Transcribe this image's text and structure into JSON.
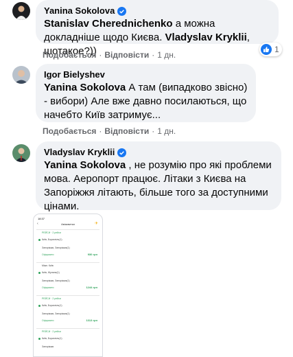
{
  "comments": [
    {
      "author": "Yanina Sokolova",
      "verified": true,
      "mention1": "Stanislav Cherednichenko",
      "text1": " а можна докладніше щодо Києва. ",
      "mention2": "Vladyslav Kryklii",
      "text2": ", шотакое?))",
      "like": "Подобається",
      "reply": "Відповісти",
      "time": "1 дн.",
      "reactions": "1"
    },
    {
      "author": "Igor Bielyshev",
      "verified": false,
      "mention1": "Yanina Sokolova",
      "text1": " А там (випадково звісно) - вибори) Але вже давно посилаються, що начебто Київ затримує...",
      "like": "Подобається",
      "reply": "Відповісти",
      "time": "1 дн."
    },
    {
      "author": "Vladyslav Kryklii",
      "verified": true,
      "mention1": "Yanina Sokolova",
      "text1": " , не розумію про які проблеми мова. Аеропорт працює. Літаки з Києва на Запоріжжя літають, більше того за доступними цінами."
    }
  ],
  "separator": "·",
  "attachment": {
    "time": "18:37",
    "title": "Авіаквитки",
    "back": "‹",
    "cards": [
      {
        "l1": "РЕЙСИ · 2 рейси",
        "l2": "Київ, Бориспіль(1)",
        "l3": "Запоріжжя, Запоріжжя(1)",
        "tag": "Оформити",
        "price": "930 грн"
      },
      {
        "l1": "Міжн. Київ",
        "l2": "Київ, Жуляни(1)",
        "l3": "Запоріжжя, Запоріжжя(1)",
        "tag": "Оформити",
        "price": "1244 грн"
      },
      {
        "l1": "РЕЙСИ · 2 рейси",
        "l2": "Київ, Бориспіль(1)",
        "l3": "Запоріжжя, Запоріжжя(1)",
        "tag": "Оформити",
        "price": "1313 грн"
      },
      {
        "l1": "РЕЙСИ · 2 рейси",
        "l2": "Київ, Бориспіль(1)",
        "l3": "Запоріжжя",
        "tag": "",
        "price": ""
      }
    ]
  },
  "colors": {
    "bubble": "#f0f2f5",
    "verified": "#1877f2",
    "meta": "#65676b"
  }
}
